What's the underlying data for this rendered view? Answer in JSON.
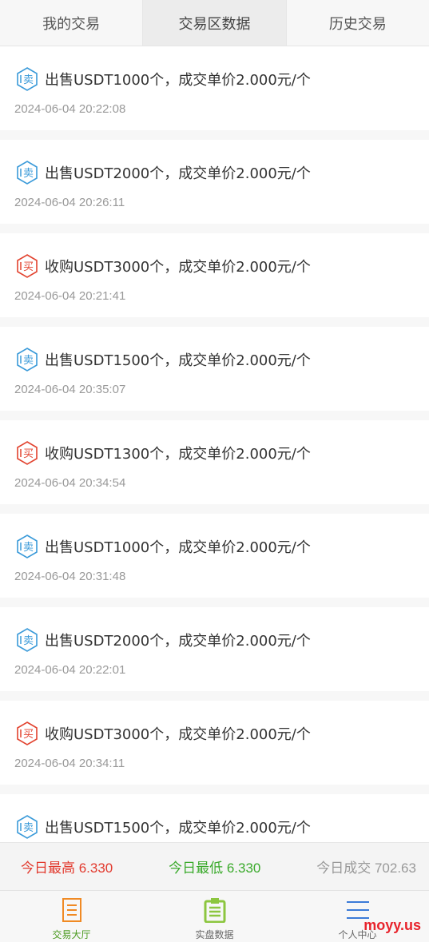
{
  "tabs": [
    {
      "label": "我的交易",
      "active": false
    },
    {
      "label": "交易区数据",
      "active": true
    },
    {
      "label": "历史交易",
      "active": false
    }
  ],
  "trades": [
    {
      "type": "sell",
      "badge": "卖",
      "text": "出售USDT1000个，成交单价2.000元/个",
      "time": "2024-06-04 20:22:08"
    },
    {
      "type": "sell",
      "badge": "卖",
      "text": "出售USDT2000个，成交单价2.000元/个",
      "time": "2024-06-04 20:26:11"
    },
    {
      "type": "buy",
      "badge": "买",
      "text": "收购USDT3000个，成交单价2.000元/个",
      "time": "2024-06-04 20:21:41"
    },
    {
      "type": "sell",
      "badge": "卖",
      "text": "出售USDT1500个，成交单价2.000元/个",
      "time": "2024-06-04 20:35:07"
    },
    {
      "type": "buy",
      "badge": "买",
      "text": "收购USDT1300个，成交单价2.000元/个",
      "time": "2024-06-04 20:34:54"
    },
    {
      "type": "sell",
      "badge": "卖",
      "text": "出售USDT1000个，成交单价2.000元/个",
      "time": "2024-06-04 20:31:48"
    },
    {
      "type": "sell",
      "badge": "卖",
      "text": "出售USDT2000个，成交单价2.000元/个",
      "time": "2024-06-04 20:22:01"
    },
    {
      "type": "buy",
      "badge": "买",
      "text": "收购USDT3000个，成交单价2.000元/个",
      "time": "2024-06-04 20:34:11"
    },
    {
      "type": "sell",
      "badge": "卖",
      "text": "出售USDT1500个，成交单价2.000元/个",
      "time": ""
    }
  ],
  "stats": {
    "high": "今日最高 6.330",
    "low": "今日最低 6.330",
    "volume": "今日成交 702.63"
  },
  "nav": [
    {
      "label": "交易大厅",
      "icon": "document-icon",
      "active": true
    },
    {
      "label": "实盘数据",
      "icon": "clipboard-icon",
      "active": false
    },
    {
      "label": "个人中心",
      "icon": "menu-icon",
      "active": false
    }
  ],
  "colors": {
    "sell": "#3a9ad9",
    "buy": "#e2422e",
    "high": "#e23a2e",
    "low": "#3aaa2b",
    "nav_active": "#4a9a1f",
    "nav_doc": "#f08a24",
    "nav_clip": "#8cc63f",
    "nav_menu": "#3b7bd8"
  },
  "watermark": "moyy.us"
}
